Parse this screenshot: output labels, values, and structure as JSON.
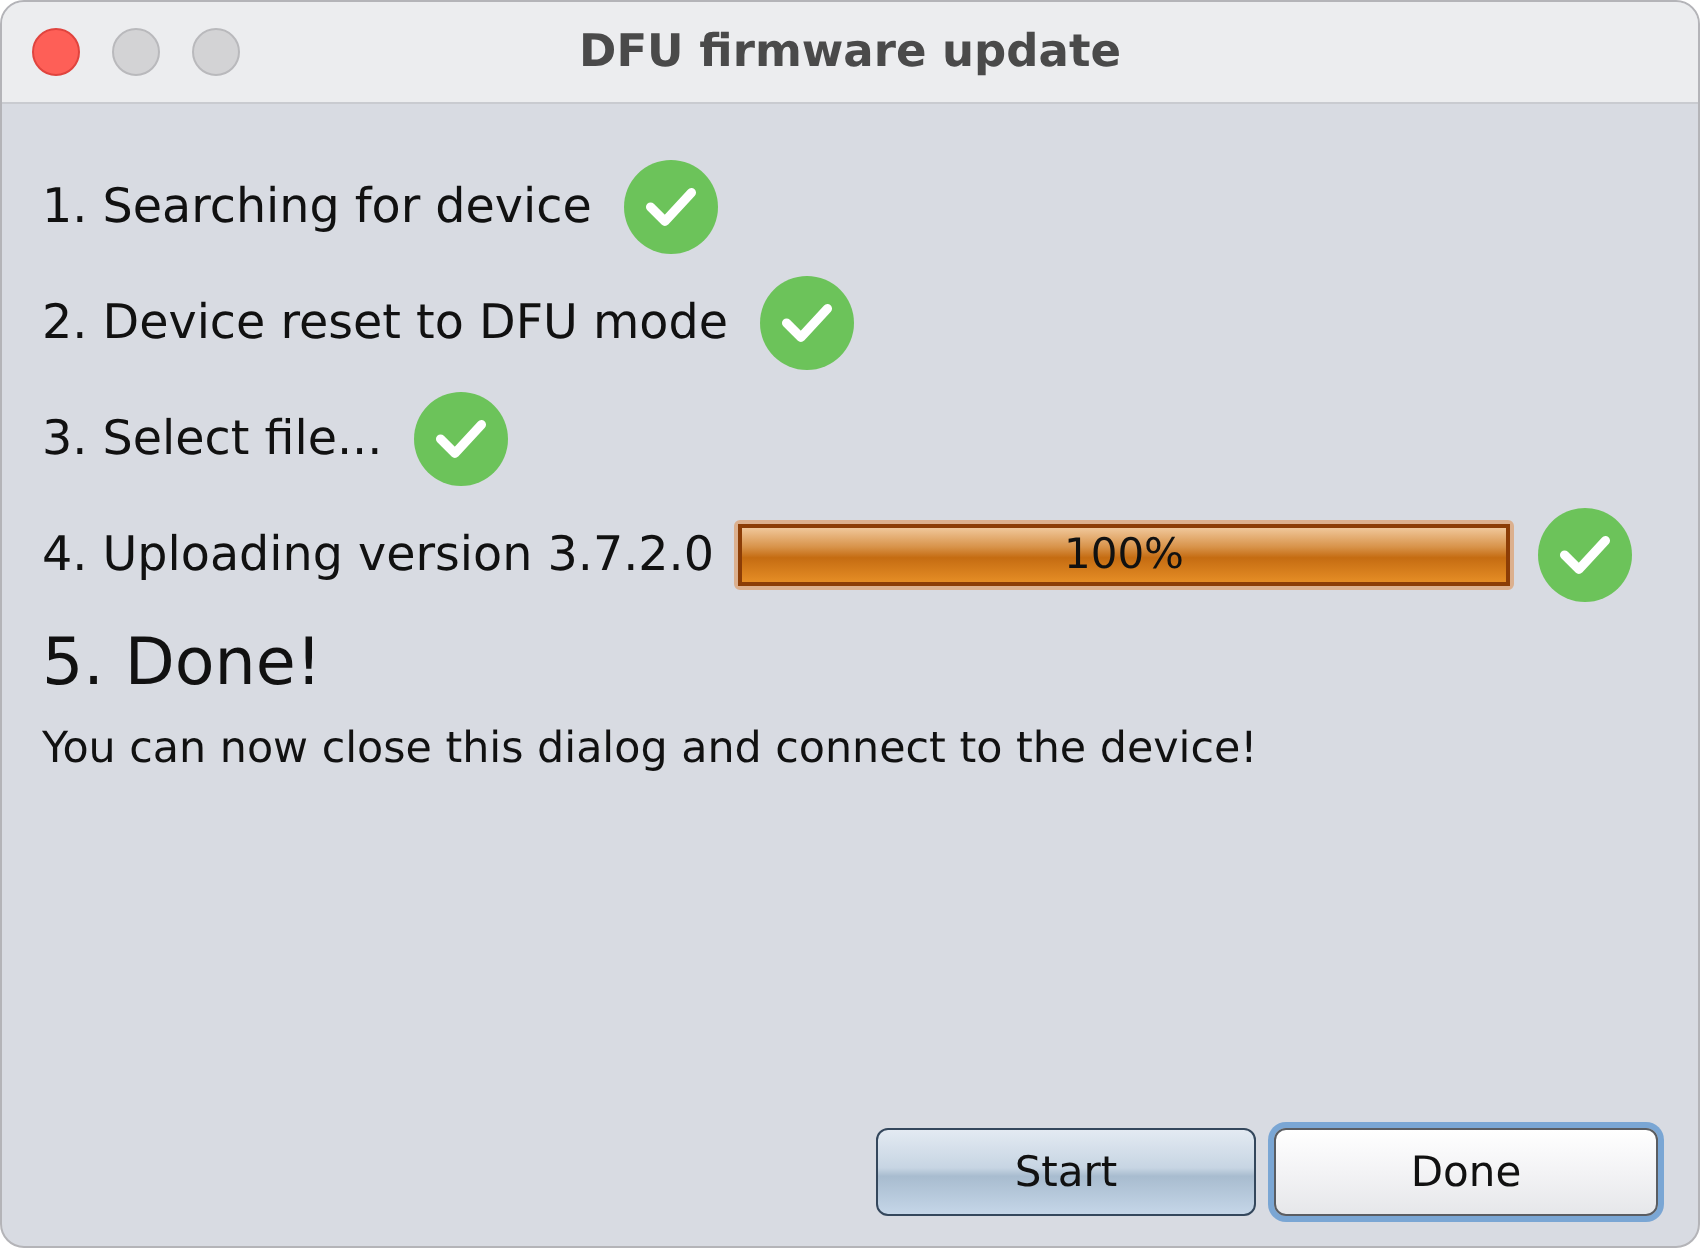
{
  "window": {
    "title": "DFU firmware update",
    "controls": [
      {
        "kind": "close",
        "enabled": true
      },
      {
        "kind": "minimize",
        "enabled": false
      },
      {
        "kind": "zoom",
        "enabled": false
      }
    ]
  },
  "steps": [
    {
      "label": "1. Searching for device",
      "done": true
    },
    {
      "label": "2. Device reset to DFU mode",
      "done": true
    },
    {
      "label": "3. Select file...",
      "done": true
    },
    {
      "label": "4. Uploading version 3.7.2.0",
      "done": true,
      "progress": {
        "level": 1,
        "reading": "100%"
      }
    }
  ],
  "result": {
    "heading": "5. Done!",
    "message": "You can now close this dialog and connect to the device!"
  },
  "buttons": [
    {
      "label": "Start",
      "default": true,
      "focused": false
    },
    {
      "label": "Done",
      "default": false,
      "focused": true
    }
  ]
}
